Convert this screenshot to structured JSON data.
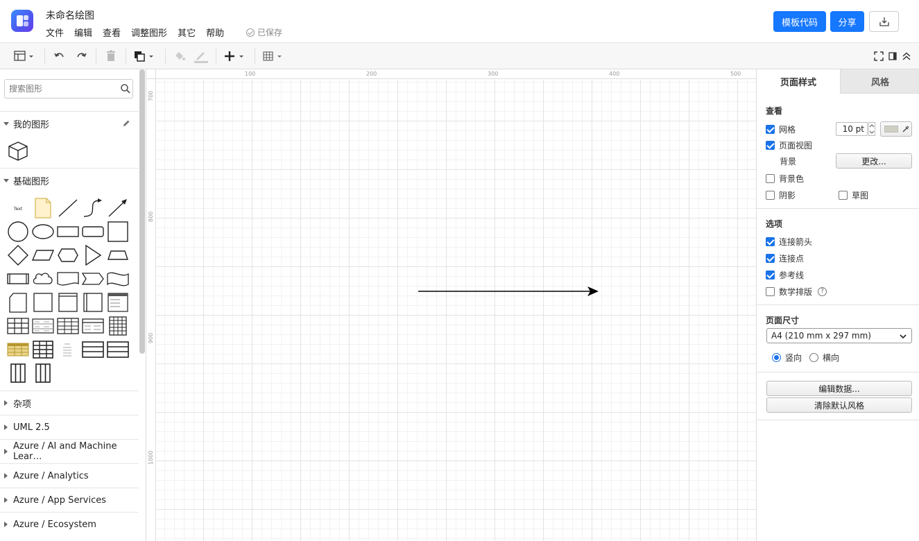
{
  "header": {
    "title": "未命名绘图",
    "menu": [
      "文件",
      "编辑",
      "查看",
      "调整图形",
      "其它",
      "帮助"
    ],
    "save_status": "已保存",
    "template_button": "模板代码",
    "share_button": "分享"
  },
  "sidebar": {
    "search_placeholder": "搜索图形",
    "my_shapes": "我的图形",
    "basic_shapes": "基础图形",
    "text_shape_label": "Text",
    "collapsed_sections": [
      "杂项",
      "UML 2.5",
      "Azure / AI and Machine Lear…",
      "Azure / Analytics",
      "Azure / App Services",
      "Azure / Ecosystem"
    ]
  },
  "canvas": {
    "ruler_top": [
      "100",
      "200",
      "300",
      "400",
      "500"
    ],
    "ruler_left": [
      "700",
      "800",
      "900",
      "1000"
    ]
  },
  "format_panel": {
    "tab_page": "页面样式",
    "tab_style": "风格",
    "view_title": "查看",
    "grid_label": "网格",
    "grid_checked": true,
    "grid_size": "10 pt",
    "grid_color": "#d0cfc4",
    "page_view_label": "页面视图",
    "page_view_checked": true,
    "background_label": "背景",
    "change_button": "更改...",
    "bg_color_label": "背景色",
    "bg_color_checked": false,
    "shadow_label": "阴影",
    "shadow_checked": false,
    "sketch_label": "草图",
    "sketch_checked": false,
    "options_title": "选项",
    "connect_arrows": "连接箭头",
    "connect_points": "连接点",
    "guides": "参考线",
    "math_typesetting": "数学排版",
    "page_size_title": "页面尺寸",
    "page_size_value": "A4 (210 mm x 297 mm)",
    "portrait": "竖向",
    "landscape": "横向",
    "orientation": "portrait",
    "edit_data_button": "编辑数据...",
    "clear_style_button": "清除默认风格"
  },
  "colors": {
    "primary": "#1677ff",
    "checkbox": "#1a73e8"
  }
}
